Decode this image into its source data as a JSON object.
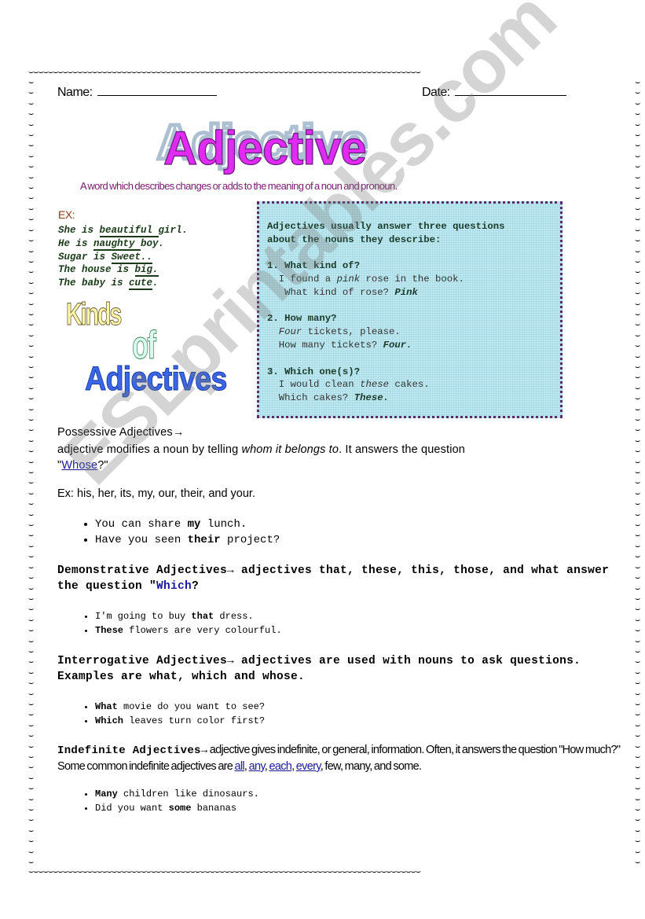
{
  "border": {
    "glyph": "⌣"
  },
  "header": {
    "name_label": "Name:",
    "date_label": "Date:"
  },
  "title": "Adjective",
  "definition": "A word which describes changes or adds to the meaning of a noun and pronoun.",
  "examples": {
    "label": "EX:",
    "sentences": [
      {
        "before": "She is ",
        "underlined": "beautiful ",
        "after": "girl."
      },
      {
        "before": "He is ",
        "underlined": "naughty ",
        "after": "boy."
      },
      {
        "before": "Sugar is ",
        "underlined": "Sweet..",
        "after": ""
      },
      {
        "before": "The house is ",
        "underlined": "big.",
        "after": ""
      },
      {
        "before": "The baby is ",
        "underlined": "cute",
        "after": "."
      }
    ]
  },
  "kinds_art": {
    "line1": "Kinds",
    "line2": "of",
    "line3": "Adjectives"
  },
  "question_box": {
    "intro_line1": "Adjectives usually answer three questions",
    "intro_line2": "about the nouns they describe:",
    "questions": [
      {
        "heading": "1. What kind of?",
        "example_pre": "  I found a ",
        "example_em": "pink",
        "example_post": " rose in the book.",
        "question_text": "   What kind of rose? ",
        "answer": "Pink"
      },
      {
        "heading": "2. How many?",
        "example_pre": "  ",
        "example_em": "Four",
        "example_post": " tickets, please.",
        "question_text": "  How many tickets? ",
        "answer": "Four."
      },
      {
        "heading": "3. Which one(s)?",
        "example_pre": "  I would clean ",
        "example_em": "these",
        "example_post": " cakes.",
        "question_text": "  Which cakes? ",
        "answer": "These."
      }
    ]
  },
  "possessive": {
    "heading": "Possessive Adjectives→",
    "body_pre": "adjective modifies a noun by telling ",
    "body_em": "whom it belongs to",
    "body_post": ". It answers the question",
    "quote_open": "\"",
    "link": "Whose",
    "quote_close": "?\"",
    "examples_line": "Ex: his, her, its, my, our, their, and your.",
    "list": [
      {
        "pre": "You can share ",
        "bold": "my",
        "post": " lunch."
      },
      {
        "pre": "Have you seen ",
        "bold": "their",
        "post": " project?"
      }
    ]
  },
  "demonstrative": {
    "heading": "Demonstrative Adjectives→ adjectives that, these, this, those, and what answer the question \"",
    "link": "Which",
    "after": "?",
    "list": [
      {
        "pre": "I'm going to buy ",
        "bold": "that",
        "post": " dress."
      },
      {
        "pre": "",
        "bold": "These",
        "post": " flowers are very colourful."
      }
    ]
  },
  "interrogative": {
    "heading": "Interrogative Adjectives→ adjectives are used with nouns to ask questions. Examples are what, which and whose.",
    "list": [
      {
        "pre": "",
        "bold": "What",
        "post": " movie do you want to see?"
      },
      {
        "pre": "",
        "bold": "Which",
        "post": " leaves turn color first?"
      }
    ]
  },
  "indefinite": {
    "heading": "Indefinite Adjectives→",
    "body": " adjective gives indefinite, or general, information. Often, it answers the question \"How much?\" Some common indefinite adjectives are ",
    "links": [
      "all",
      "any",
      "each",
      "every"
    ],
    "tail": " few, many, and some.",
    "list": [
      {
        "pre": "",
        "bold": "Many",
        "post": " children like dinosaurs."
      },
      {
        "pre": "Did you want ",
        "bold": "some",
        "post": " bananas"
      }
    ]
  },
  "watermark": "ESLprintables.com"
}
